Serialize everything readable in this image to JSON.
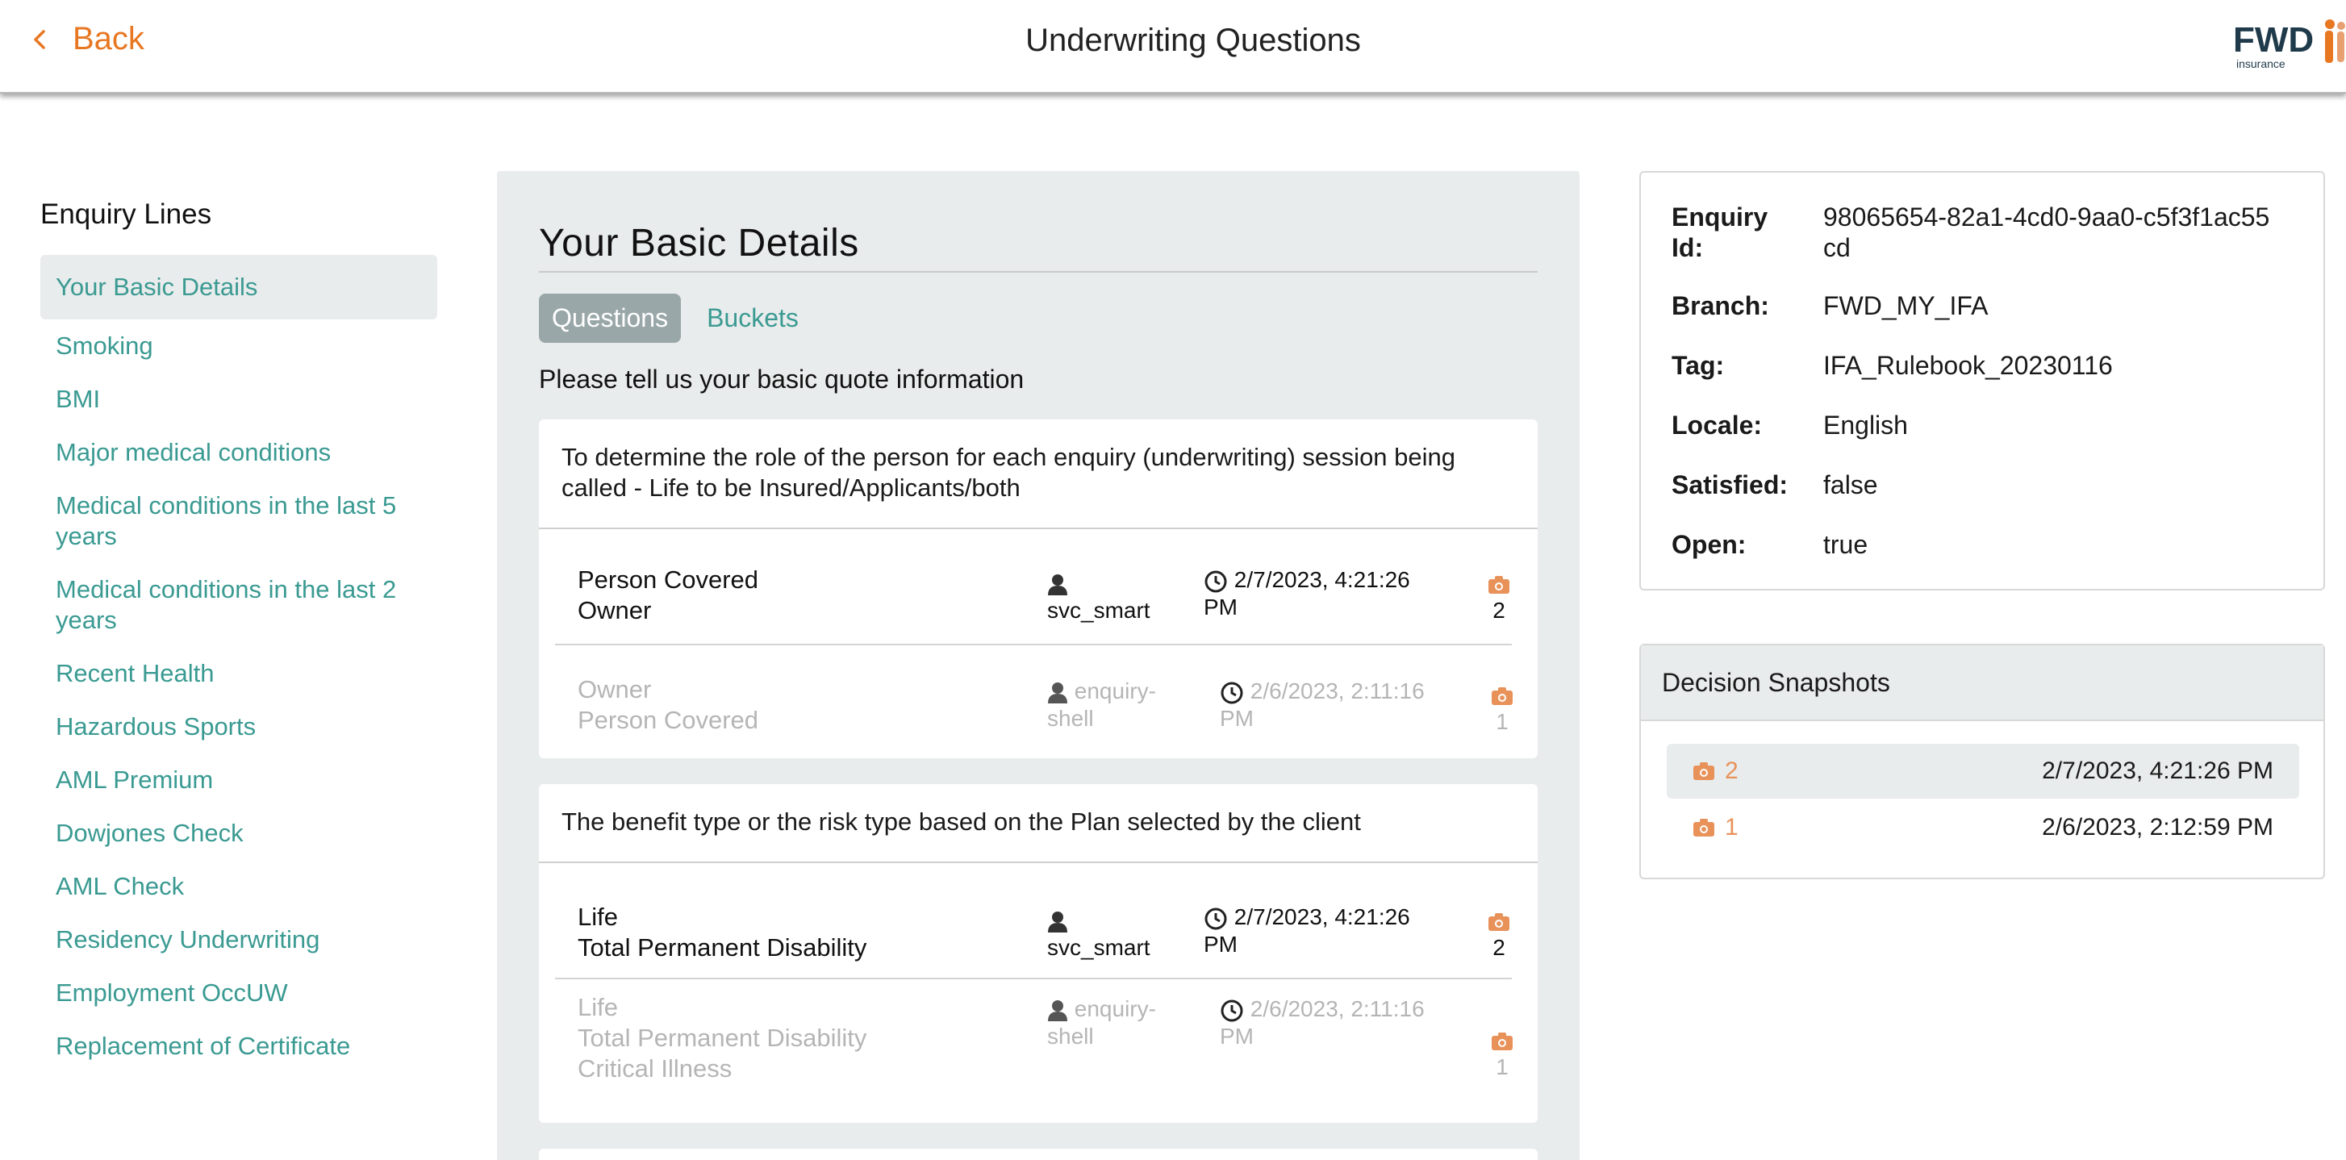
{
  "header": {
    "back_label": "Back",
    "title": "Underwriting Questions",
    "logo_text": "FWD",
    "logo_sub": "insurance",
    "accent_color": "#e87722"
  },
  "sidebar": {
    "title": "Enquiry Lines",
    "items": [
      {
        "label": "Your Basic Details",
        "active": true
      },
      {
        "label": "Smoking"
      },
      {
        "label": "BMI"
      },
      {
        "label": "Major medical conditions"
      },
      {
        "label": "Medical conditions in the last 5 years"
      },
      {
        "label": "Medical conditions in the last 2 years"
      },
      {
        "label": "Recent Health"
      },
      {
        "label": "Hazardous Sports"
      },
      {
        "label": "AML Premium"
      },
      {
        "label": "Dowjones Check"
      },
      {
        "label": "AML Check"
      },
      {
        "label": "Residency Underwriting"
      },
      {
        "label": "Employment OccUW"
      },
      {
        "label": "Replacement of Certificate"
      }
    ]
  },
  "main": {
    "heading": "Your Basic Details",
    "tabs": [
      {
        "label": "Questions",
        "active": true
      },
      {
        "label": "Buckets"
      }
    ],
    "intro": "Please tell us your basic quote information",
    "questions": [
      {
        "text": "To determine the role of the person for each enquiry (underwriting) session being called - Life to be Insured/Applicants/both",
        "answers": [
          {
            "values": [
              "Person Covered",
              "Owner"
            ],
            "user": "svc_smart",
            "time": "2/7/2023, 4:21:26 PM",
            "snapshot": "2",
            "current": true
          },
          {
            "values": [
              "Owner",
              "Person Covered"
            ],
            "user": "enquiry-shell",
            "time": "2/6/2023, 2:11:16 PM",
            "snapshot": "1",
            "current": false
          }
        ]
      },
      {
        "text": "The benefit type or the risk type based on the Plan selected by the client",
        "answers": [
          {
            "values": [
              "Life",
              "Total Permanent Disability"
            ],
            "user": "svc_smart",
            "time": "2/7/2023, 4:21:26 PM",
            "snapshot": "2",
            "current": true
          },
          {
            "values": [
              "Life",
              "Total Permanent Disability",
              "Critical Illness"
            ],
            "user": "enquiry-shell",
            "time": "2/6/2023, 2:11:16 PM",
            "snapshot": "1",
            "current": false
          }
        ]
      }
    ]
  },
  "info": {
    "rows": [
      {
        "key": "Enquiry Id:",
        "value": "98065654-82a1-4cd0-9aa0-c5f3f1ac55cd"
      },
      {
        "key": "Branch:",
        "value": "FWD_MY_IFA"
      },
      {
        "key": "Tag:",
        "value": "IFA_Rulebook_20230116"
      },
      {
        "key": "Locale:",
        "value": "English"
      },
      {
        "key": "Satisfied:",
        "value": "false"
      },
      {
        "key": "Open:",
        "value": "true"
      }
    ]
  },
  "snapshots": {
    "title": "Decision Snapshots",
    "items": [
      {
        "id": "2",
        "time": "2/7/2023, 4:21:26 PM",
        "active": true
      },
      {
        "id": "1",
        "time": "2/6/2023, 2:12:59 PM"
      }
    ]
  }
}
